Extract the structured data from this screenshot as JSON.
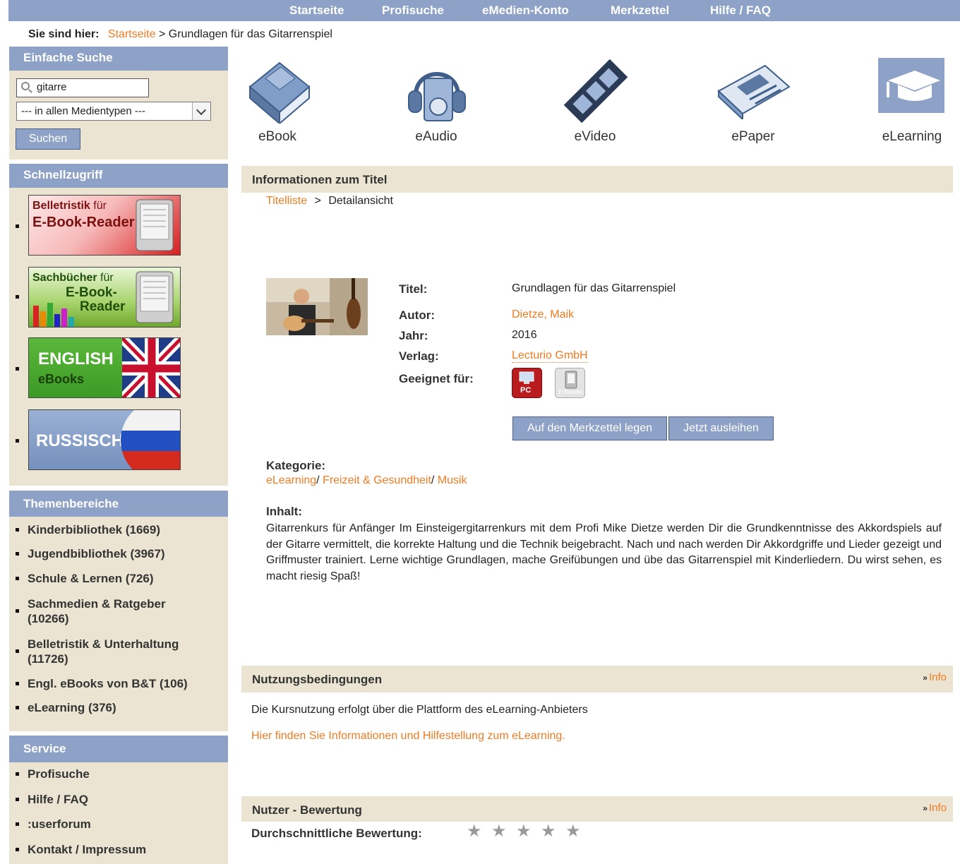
{
  "topnav": [
    "Startseite",
    "Profisuche",
    "eMedien-Konto",
    "Merkzettel",
    "Hilfe / FAQ"
  ],
  "breadcrumb": {
    "label": "Sie sind hier:",
    "home": "Startseite",
    "sep": ">",
    "current": "Grundlagen für das Gitarrenspiel"
  },
  "search": {
    "header": "Einfache Suche",
    "value": "gitarre",
    "media_type": "--- in allen Medientypen ---",
    "button": "Suchen"
  },
  "quickaccess": {
    "header": "Schnellzugriff",
    "banners": [
      {
        "line1": "Belletristik",
        "line1b": "für",
        "line2": "E-Book-Reader"
      },
      {
        "line1": "Sachbücher",
        "line1b": "für",
        "line2": "E-Book-",
        "line3": "Reader"
      },
      {
        "line1": "ENGLISH",
        "line2": "eBooks"
      },
      {
        "line1": "RUSSISCH"
      }
    ]
  },
  "themes": {
    "header": "Themenbereiche",
    "items": [
      "Kinderbibliothek (1669)",
      "Jugendbibliothek (3967)",
      "Schule & Lernen (726)",
      "Sachmedien & Ratgeber (10266)",
      "Belletristik & Unterhaltung (11726)",
      "Engl. eBooks von B&T (106)",
      "eLearning (376)"
    ]
  },
  "service": {
    "header": "Service",
    "items": [
      "Profisuche",
      "Hilfe / FAQ",
      ":userforum",
      "Kontakt / Impressum"
    ]
  },
  "media_types": [
    "eBook",
    "eAudio",
    "eVideo",
    "ePaper",
    "eLearning"
  ],
  "info": {
    "header": "Informationen zum Titel",
    "trail_link": "Titelliste",
    "trail_sep": ">",
    "trail_current": "Detailansicht",
    "title_label": "Titel:",
    "title": "Grundlagen für das Gitarrenspiel",
    "author_label": "Autor:",
    "author": "Dietze, Maik",
    "year_label": "Jahr:",
    "year": "2016",
    "publisher_label": "Verlag:",
    "publisher": "Lecturio GmbH",
    "suitable_label": "Geeignet für:",
    "device_pc": "PC",
    "device_reader": "E-Reader",
    "btn_watchlist": "Auf den Merkzettel legen",
    "btn_borrow": "Jetzt ausleihen",
    "category_label": "Kategorie:",
    "categories": [
      "eLearning",
      "Freizeit & Gesundheit",
      "Musik"
    ],
    "content_label": "Inhalt:",
    "content": "Gitarrenkurs für Anfänger Im Einsteigergitarrenkurs mit dem Profi Mike Dietze werden Dir die Grundkenntnisse des Akkordspiels auf der Gitarre vermittelt, die korrekte Haltung und die Technik beigebracht. Nach und nach werden Dir Akkordgriffe und Lieder gezeigt und Griffmuster trainiert. Lerne wichtige Grundlagen, mache Greifübungen und übe das Gitarrenspiel mit Kinderliedern. Du wirst sehen, es macht riesig Spaß!"
  },
  "terms": {
    "header": "Nutzungsbedingungen",
    "info": "Info",
    "text": "Die Kursnutzung erfolgt über die Plattform des eLearning-Anbieters",
    "link": "Hier finden Sie Informationen und Hilfestellung zum eLearning."
  },
  "rating": {
    "header": "Nutzer - Bewertung",
    "info": "Info",
    "label": "Durchschnittliche Bewertung:",
    "stars_max": 5,
    "stars_filled": 0
  },
  "colors": {
    "nav": "#8da2c6",
    "panel": "#ece4d2",
    "link": "#f07b22"
  }
}
